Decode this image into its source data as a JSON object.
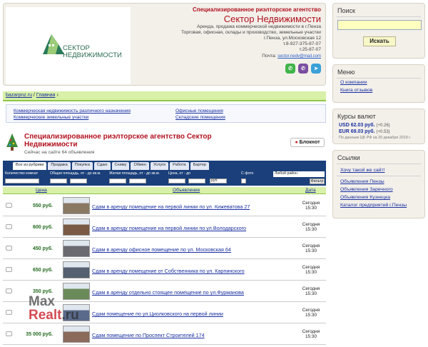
{
  "header": {
    "logo_line1": "СЕКТОР",
    "logo_line2": "НЕДВИЖИМОСТИ",
    "top_title": "Специализированное риэлторское агентство",
    "big_title": "Сектор Недвижимости",
    "line1": "Аренда, продажа коммерческой недвижимости в г.Пенза",
    "line2": "Торговая, офисная, склады и производство, земельные участки",
    "phone1": "т.8-927-375-87-07",
    "phone2": "т.25-87-07",
    "address": "г.Пенза, ул.Московская 12",
    "mail_label": "Почта:",
    "mail": "sector.nedv@mail.com",
    "socials": [
      {
        "name": "whatsapp",
        "glyph": "✆",
        "color": "#3fb44a"
      },
      {
        "name": "viber",
        "glyph": "✆",
        "color": "#7b4fa0"
      },
      {
        "name": "telegram",
        "glyph": "➤",
        "color": "#3aa0d8"
      }
    ]
  },
  "breadcrumb": {
    "site": "bazarpnz.ru",
    "sep": "/",
    "page": "Главная",
    "arrow": "›"
  },
  "categories": {
    "left1": "Коммерческая недвижимость различного назначения",
    "left2": "Коммерческие земельные участки",
    "right1": "Офисные помещения",
    "right2": "Складские помещения"
  },
  "company": {
    "title": "Специализированное риэлторское агентство Сектор Недвижимости",
    "subtitle": "Сейчас на сайте 64 объявления",
    "notebook": "Блокнот"
  },
  "tabs": [
    "Все из рубрики",
    "Продажа",
    "Покупка",
    "Сдаю",
    "Сниму",
    "Обмен",
    "Услуги",
    "Работа",
    "Бартер"
  ],
  "filters": {
    "qty": "Количество комнат",
    "area_total": "Общая площадь, от - до кв.м.",
    "area_living": "Жилая площадь, от - до кв.м.",
    "area_common": "Общая площадь, от - до кв.м.",
    "price": "Цена, от - до",
    "photo": "С фото",
    "district": "Любой район",
    "currency": "руб.",
    "button": "Фильтр"
  },
  "table": {
    "col_price": "Цена",
    "col_ad": "Объявление",
    "col_date": "Дата",
    "rows": [
      {
        "price": "550 руб.",
        "ad": "Сдам в аренду помещение на первой линии по ул. Кижеватова 27",
        "date1": "Сегодня",
        "date2": "15:30",
        "thumb": "#8a7a64"
      },
      {
        "price": "600 руб.",
        "ad": "Сдам в аренду помещение на первой линии по ул.Володарского",
        "date1": "Сегодня",
        "date2": "15:30",
        "thumb": "#7a5a44"
      },
      {
        "price": "450 руб.",
        "ad": "Сдам в аренду офисное помещение по ул. Московская 64",
        "date1": "Сегодня",
        "date2": "15:30",
        "thumb": "#6a6a70"
      },
      {
        "price": "650 руб.",
        "ad": "Сдам в аренду помещение от Собственника по ул. Карпинского",
        "date1": "Сегодня",
        "date2": "15:30",
        "thumb": "#556070"
      },
      {
        "price": "350 руб.",
        "ad": "Сдам в аренду отдельно стоящее помещение по ул.Фурманова",
        "date1": "Сегодня",
        "date2": "15:30",
        "thumb": "#6b8a5a"
      },
      {
        "price": "",
        "ad": "Сдам помещение по ул.Циолковского на первой линии",
        "date1": "Сегодня",
        "date2": "15:30",
        "thumb": "#5a6a8a"
      },
      {
        "price": "35 000 руб.",
        "ad": "Сдам помещение по Проспект Строителей 174",
        "date1": "Сегодня",
        "date2": "15:30",
        "thumb": "#8a6a5a"
      }
    ]
  },
  "watermark": {
    "part1": "Max",
    "part2": "Realt",
    "part3": ".ru"
  },
  "sidebar": {
    "search_title": "Поиск",
    "search_value": "",
    "search_button": "Искать",
    "menu_title": "Меню",
    "menu_items": [
      "О компании",
      "Книга отзывов"
    ],
    "rates_title": "Курсы валют",
    "usd": "USD 62.03 руб.",
    "usd_delta": "(+0.26)",
    "eur": "EUR 69.03 руб.",
    "eur_delta": "(+0.53)",
    "rates_note": "По данным ЦБ РФ на 20 декабря 2019 г.",
    "links_title": "Ссылки",
    "link_top": "Хочу такой же сайт!",
    "links": [
      "Объявления Пензы",
      "Объявления Заречного",
      "Объявления Кузнецка",
      "Каталог предприятий г.Пензы"
    ]
  }
}
